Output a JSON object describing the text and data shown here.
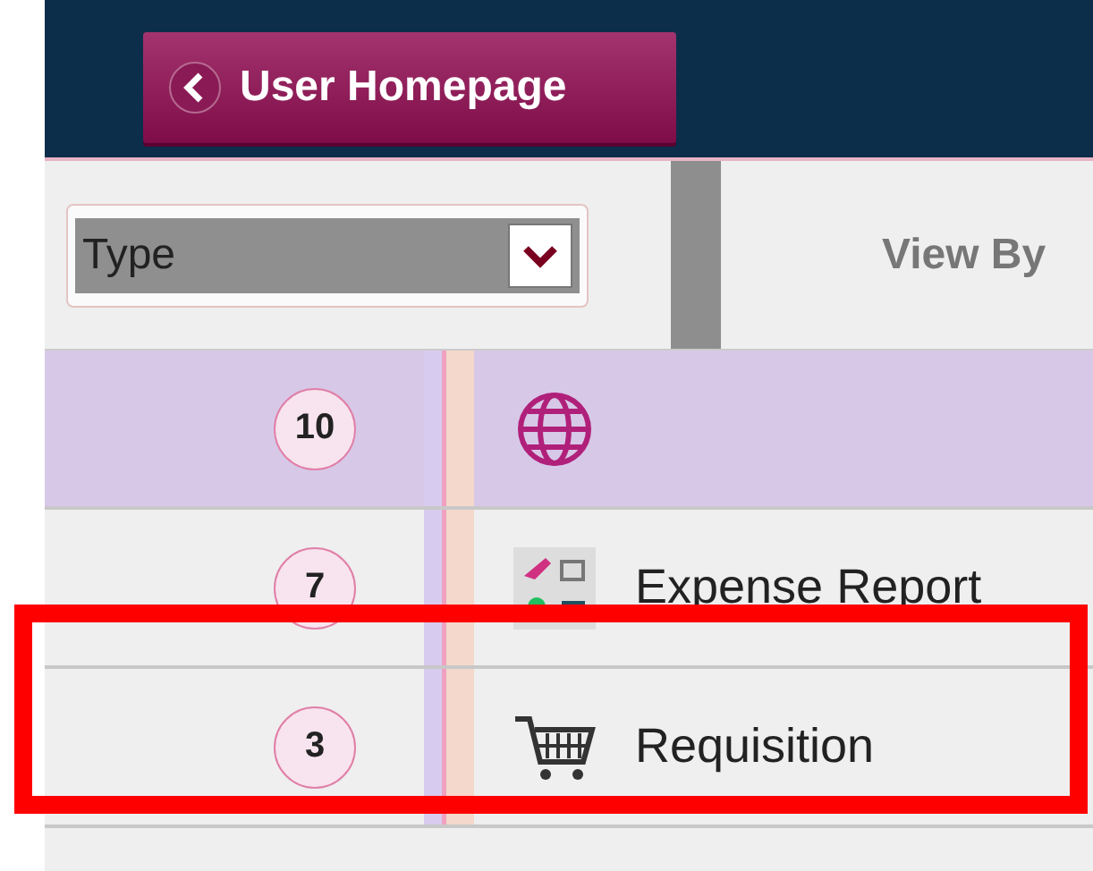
{
  "header": {
    "back_button": "User Homepage"
  },
  "toolbar": {
    "type_select": {
      "value": "Type"
    },
    "view_by": "View By"
  },
  "rows": [
    {
      "count": "10",
      "kind": "globe",
      "label": "",
      "selected": true,
      "highlighted": false
    },
    {
      "count": "7",
      "kind": "travel",
      "label": "Expense Report",
      "selected": false,
      "highlighted": false
    },
    {
      "count": "3",
      "kind": "cart",
      "label": "Requisition",
      "selected": false,
      "highlighted": true
    }
  ]
}
